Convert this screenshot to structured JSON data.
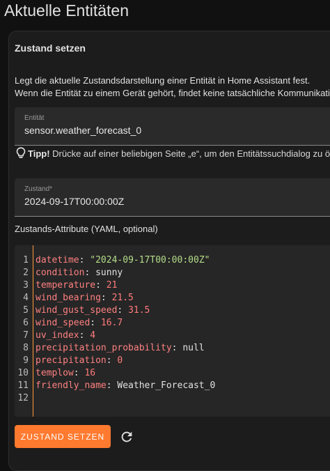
{
  "page": {
    "title": "Aktuelle Entitäten"
  },
  "card": {
    "title": "Zustand setzen",
    "desc_line1": "Legt die aktuelle Zustandsdarstellung einer Entität in Home Assistant fest.",
    "desc_line2": "Wenn die Entität zu einem Gerät gehört, findet keine tatsächliche Kommunikation"
  },
  "entity_field": {
    "label": "Entität",
    "value": "sensor.weather_forecast_0"
  },
  "tip": {
    "bold": "Tipp!",
    "text": " Drücke auf einer beliebigen Seite „e“, um den Entitätssuchdialog zu öffnen"
  },
  "state_field": {
    "label": "Zustand*",
    "value": "2024-09-17T00:00:00Z"
  },
  "attributes": {
    "label": "Zustands-Attribute (YAML, optional)",
    "lines": [
      {
        "n": "1",
        "key": "datetime",
        "value": "\"2024-09-17T00:00:00Z\"",
        "type": "s"
      },
      {
        "n": "2",
        "key": "condition",
        "value": "sunny",
        "type": "p"
      },
      {
        "n": "3",
        "key": "temperature",
        "value": "21",
        "type": "n"
      },
      {
        "n": "4",
        "key": "wind_bearing",
        "value": "21.5",
        "type": "n"
      },
      {
        "n": "5",
        "key": "wind_gust_speed",
        "value": "31.5",
        "type": "n"
      },
      {
        "n": "6",
        "key": "wind_speed",
        "value": "16.7",
        "type": "n"
      },
      {
        "n": "7",
        "key": "uv_index",
        "value": "4",
        "type": "n"
      },
      {
        "n": "8",
        "key": "precipitation_probability",
        "value": "null",
        "type": "p"
      },
      {
        "n": "9",
        "key": "precipitation",
        "value": "0",
        "type": "n"
      },
      {
        "n": "10",
        "key": "templow",
        "value": "16",
        "type": "n"
      },
      {
        "n": "11",
        "key": "friendly_name",
        "value": "Weather_Forecast_0",
        "type": "p"
      },
      {
        "n": "12",
        "key": "",
        "value": "",
        "type": "p"
      }
    ]
  },
  "actions": {
    "set_state_label": "ZUSTAND SETZEN",
    "refresh_icon": "refresh-icon"
  },
  "colors": {
    "accent": "#ff7a2f",
    "background": "#111111",
    "card": "#1c1c1c"
  }
}
